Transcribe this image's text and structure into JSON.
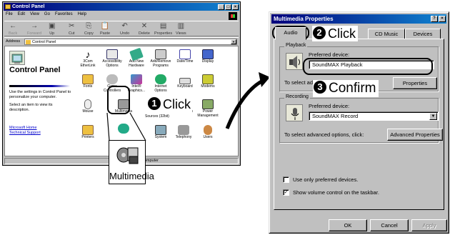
{
  "control_panel": {
    "title": "Control Panel",
    "menu": [
      "File",
      "Edit",
      "View",
      "Go",
      "Favorites",
      "Help"
    ],
    "toolbar": [
      "Back",
      "Forward",
      "Up",
      "Cut",
      "Copy",
      "Paste",
      "Undo",
      "Delete",
      "Properties",
      "Views"
    ],
    "address_label": "Address",
    "address_value": "Control Panel",
    "heading": "Control Panel",
    "description_1": "Use the settings in Control Panel to personalize your computer.",
    "description_2": "Select an item to view its description.",
    "link_home": "Microsoft Home",
    "link_support": "Technical Support",
    "icons": [
      {
        "label": "3Com EtherLink"
      },
      {
        "label": "Accessibility Options"
      },
      {
        "label": "Add New Hardware"
      },
      {
        "label": "Add/Remove Programs"
      },
      {
        "label": "Date/Time"
      },
      {
        "label": "Display"
      },
      {
        "label": "Fonts"
      },
      {
        "label": "Game Controllers"
      },
      {
        "label": "Intel® Graphics..."
      },
      {
        "label": "Internet Options"
      },
      {
        "label": "Keyboard"
      },
      {
        "label": "Modems"
      },
      {
        "label": "Mouse"
      },
      {
        "label": "Multimedia"
      },
      {
        "label": "Sources (32bit)"
      },
      {
        "label": "sswords"
      },
      {
        "label": "Power Management"
      },
      {
        "label": "Printers"
      },
      {
        "label": "System"
      },
      {
        "label": "Telephony"
      },
      {
        "label": "Users"
      }
    ],
    "status_right": "My Computer",
    "zoom_label": "Multimedia"
  },
  "callouts": {
    "click1_num": "1",
    "click1_text": "Click",
    "click2_num": "2",
    "click2_text": "Click",
    "confirm_num": "3",
    "confirm_text": "Confirm"
  },
  "dialog": {
    "title": "Multimedia Properties",
    "help_btn": "?",
    "close_btn": "×",
    "tabs": [
      "Audio",
      "CD Music",
      "Devices"
    ],
    "playback_legend": "Playback",
    "playback_label": "Preferred device:",
    "playback_value": "SoundMAX Playback",
    "playback_adv_text": "To select advance",
    "playback_props_btn": "Properties",
    "recording_legend": "Recording",
    "recording_label": "Preferred device:",
    "recording_value": "SoundMAX Record",
    "recording_adv_text": "To select advanced options, click:",
    "recording_props_btn": "Advanced Properties",
    "only_preferred": "Use only preferred devices.",
    "show_volume": "Show volume control on the taskbar.",
    "ok": "OK",
    "cancel": "Cancel",
    "apply": "Apply"
  },
  "colors": {
    "titlebar": "#00007b",
    "face": "#c0c0c0"
  }
}
